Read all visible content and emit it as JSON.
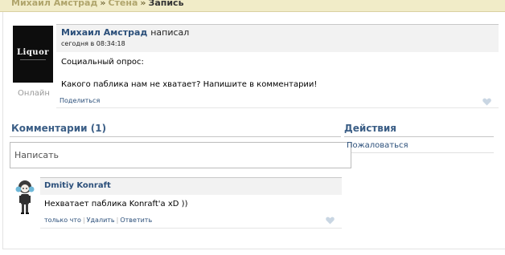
{
  "breadcrumb": {
    "author": "Михаил Амстрад",
    "separator": "»",
    "wall": "Стена",
    "current": "Запись"
  },
  "post": {
    "avatar_logo": "Liquor",
    "author": "Михаил Амстрад",
    "action": "написал",
    "time": "сегодня в 08:34:18",
    "status": "Онлайн",
    "lines": [
      "Социальный опрос:",
      "Какого паблика нам не хватает? Напишите в комментарии!"
    ],
    "share_label": "Поделиться"
  },
  "comments": {
    "title": "Комментарии (1)",
    "placeholder": "Написать",
    "items": [
      {
        "author": "Dmitiy Konraft",
        "text": "Нехватает паблика Konraft'a xD ))",
        "time": "только что",
        "delete_label": "Удалить",
        "reply_label": "Ответить"
      }
    ]
  },
  "actions": {
    "title": "Действия",
    "report_label": "Пожаловаться"
  },
  "colors": {
    "link": "#2b4f7a",
    "heading": "#3b5e86",
    "topbar": "#f1ecc8",
    "like_icon": "#c9d6e3"
  }
}
